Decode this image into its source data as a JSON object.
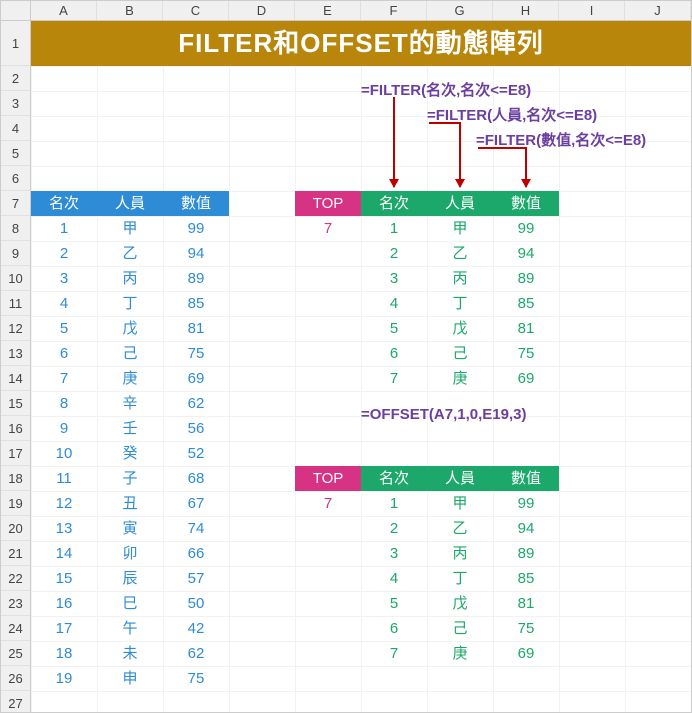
{
  "columns": [
    "A",
    "B",
    "C",
    "D",
    "E",
    "F",
    "G",
    "H",
    "I",
    "J"
  ],
  "row_heights": {
    "row1": 45,
    "default": 25
  },
  "title": "FILTER和OFFSET的動態陣列",
  "left_table": {
    "headers": [
      "名次",
      "人員",
      "數值"
    ],
    "rows": [
      [
        1,
        "甲",
        99
      ],
      [
        2,
        "乙",
        94
      ],
      [
        3,
        "丙",
        89
      ],
      [
        4,
        "丁",
        85
      ],
      [
        5,
        "戊",
        81
      ],
      [
        6,
        "己",
        75
      ],
      [
        7,
        "庚",
        69
      ],
      [
        8,
        "辛",
        62
      ],
      [
        9,
        "壬",
        56
      ],
      [
        10,
        "癸",
        52
      ],
      [
        11,
        "子",
        68
      ],
      [
        12,
        "丑",
        67
      ],
      [
        13,
        "寅",
        74
      ],
      [
        14,
        "卯",
        66
      ],
      [
        15,
        "辰",
        57
      ],
      [
        16,
        "巳",
        50
      ],
      [
        17,
        "午",
        42
      ],
      [
        18,
        "未",
        62
      ],
      [
        19,
        "申",
        75
      ]
    ]
  },
  "formulas": {
    "f1": "=FILTER(名次,名次<=E8)",
    "f2": "=FILTER(人員,名次<=E8)",
    "f3": "=FILTER(數值,名次<=E8)",
    "f4": "=OFFSET(A7,1,0,E19,3)"
  },
  "filter_table": {
    "top_label": "TOP",
    "top_value": 7,
    "headers": [
      "名次",
      "人員",
      "數值"
    ],
    "rows": [
      [
        1,
        "甲",
        99
      ],
      [
        2,
        "乙",
        94
      ],
      [
        3,
        "丙",
        89
      ],
      [
        4,
        "丁",
        85
      ],
      [
        5,
        "戊",
        81
      ],
      [
        6,
        "己",
        75
      ],
      [
        7,
        "庚",
        69
      ]
    ]
  },
  "offset_table": {
    "top_label": "TOP",
    "top_value": 7,
    "headers": [
      "名次",
      "人員",
      "數值"
    ],
    "rows": [
      [
        1,
        "甲",
        99
      ],
      [
        2,
        "乙",
        94
      ],
      [
        3,
        "丙",
        89
      ],
      [
        4,
        "丁",
        85
      ],
      [
        5,
        "戊",
        81
      ],
      [
        6,
        "己",
        75
      ],
      [
        7,
        "庚",
        69
      ]
    ]
  }
}
